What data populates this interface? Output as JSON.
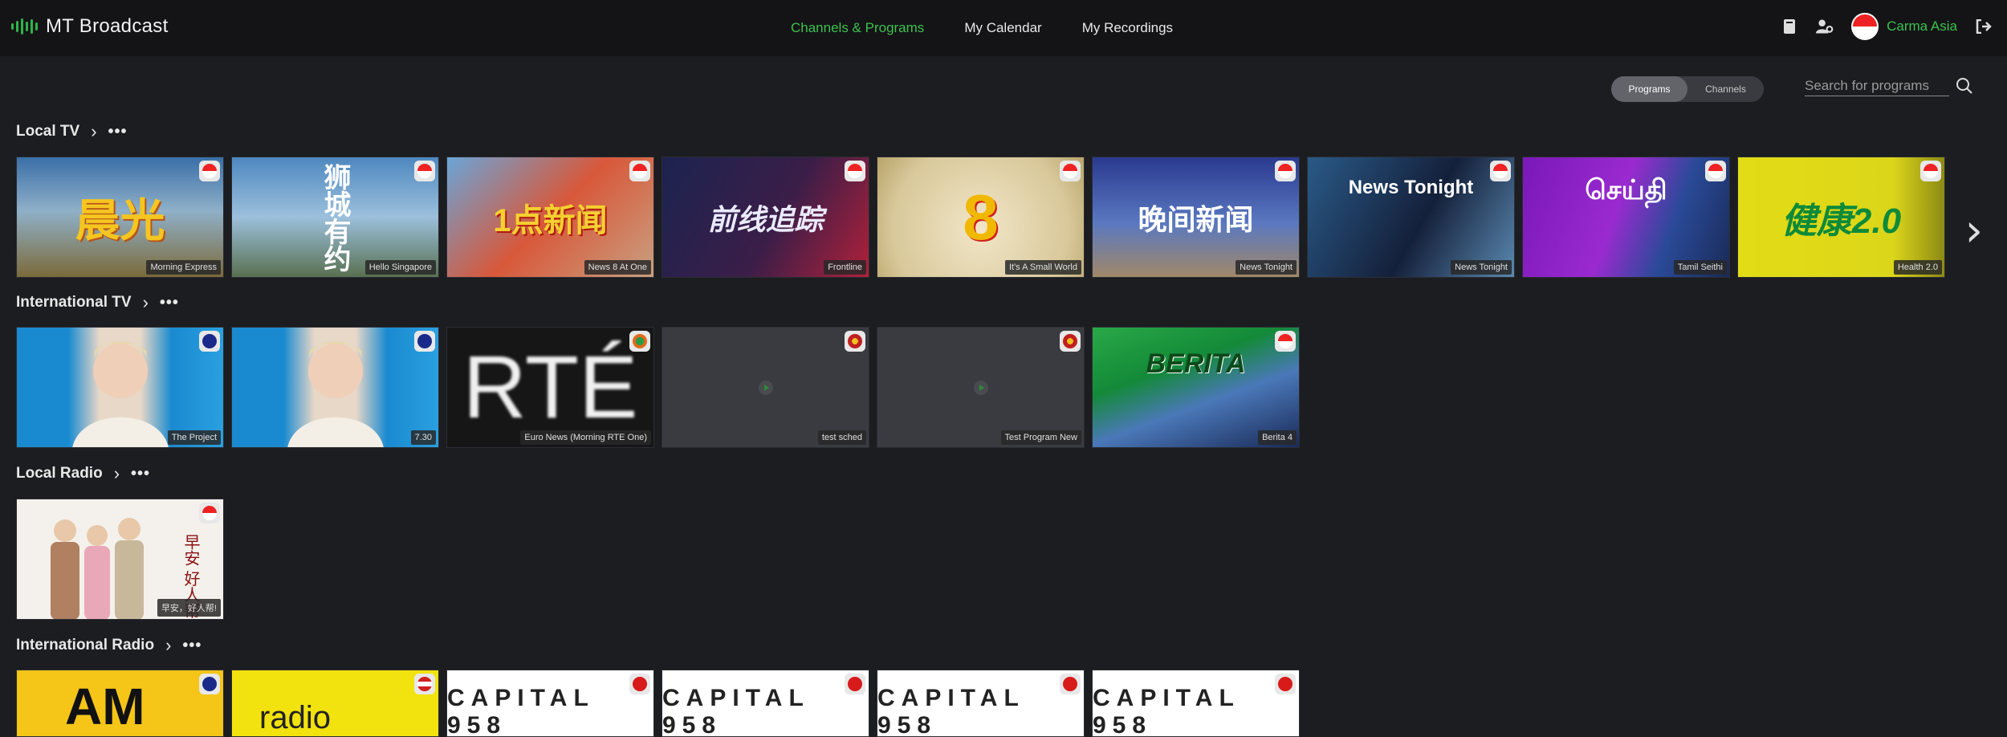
{
  "app": {
    "title": "MT Broadcast"
  },
  "nav": {
    "channels_programs": "Channels & Programs",
    "my_calendar": "My Calendar",
    "my_recordings": "My Recordings"
  },
  "user": {
    "name": "Carma Asia"
  },
  "toggle": {
    "programs": "Programs",
    "channels": "Channels"
  },
  "search": {
    "placeholder": "Search for programs"
  },
  "colors": {
    "accent": "#3bc24c",
    "background": "#1c1d21",
    "topbar": "#141417"
  },
  "rows": {
    "local_tv": {
      "title": "Local TV",
      "tiles": [
        {
          "label": "Morning Express",
          "art": "晨光"
        },
        {
          "label": "Hello Singapore",
          "art": "狮城有约"
        },
        {
          "label": "News 8 At One",
          "art": "1点新闻"
        },
        {
          "label": "Frontline",
          "art": "前线追踪"
        },
        {
          "label": "It's A Small World",
          "art": "8"
        },
        {
          "label": "News Tonight",
          "art": "晚间新闻"
        },
        {
          "label": "News Tonight",
          "art": "News Tonight"
        },
        {
          "label": "Tamil Seithi",
          "art": "செய்தி"
        },
        {
          "label": "Health 2.0",
          "art": "健康2.0"
        }
      ]
    },
    "international_tv": {
      "title": "International TV",
      "tiles": [
        {
          "label": "The Project"
        },
        {
          "label": "7.30"
        },
        {
          "label": "Euro News (Morning RTE One)",
          "art": "RTÉ"
        },
        {
          "label": "test sched"
        },
        {
          "label": "Test Program New"
        },
        {
          "label": "Berita 4",
          "art": "BERITA"
        }
      ]
    },
    "local_radio": {
      "title": "Local Radio",
      "tiles": [
        {
          "label": "早安，好人帮!",
          "art": "早安 好人帮"
        }
      ]
    },
    "international_radio": {
      "title": "International Radio",
      "tiles": [
        {
          "art": "AM"
        },
        {
          "art": "radio"
        },
        {
          "art": "CAPITAL 958"
        },
        {
          "art": "CAPITAL 958"
        },
        {
          "art": "CAPITAL 958"
        },
        {
          "art": "CAPITAL 958"
        }
      ]
    }
  }
}
